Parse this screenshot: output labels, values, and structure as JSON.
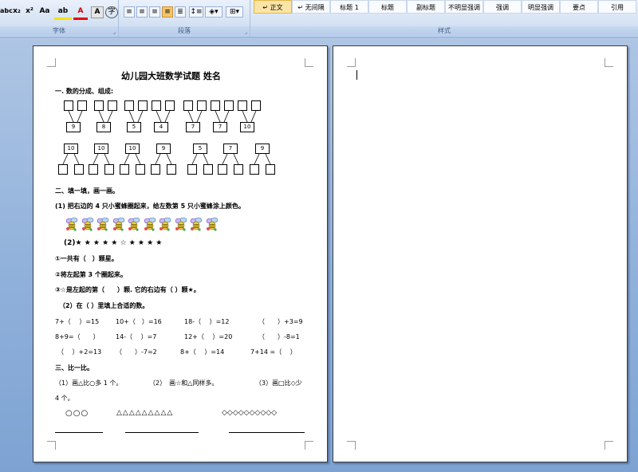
{
  "ribbon": {
    "groups": [
      {
        "label": "字体"
      },
      {
        "label": "段落"
      },
      {
        "label": "样式"
      }
    ],
    "font_buttons": [
      "abc",
      "x₂",
      "x²",
      "Aa",
      "ab",
      "A",
      "A"
    ],
    "styles": [
      "↵ 正文",
      "↵ 无间隔",
      "标题 1",
      "标题",
      "副标题",
      "不明显强调",
      "强调",
      "明显强调",
      "要点",
      "引用"
    ]
  },
  "doc": {
    "title": "幼儿园大班数学试题     姓名",
    "s1_heading": "一. 数的分成、组成:",
    "row1_numbers": [
      "9",
      "8",
      "5",
      "4",
      "7",
      "7",
      "10"
    ],
    "row2_numbers": [
      "10",
      "10",
      "10",
      "9",
      "5",
      "7",
      "9"
    ],
    "s2_heading": "二、填一填，画一画。",
    "q1": "(1) 把右边的 4 只小蜜蜂圈起来，给左数第 5 只小蜜蜂涂上颜色。",
    "q2_stars": "(2)★ ★ ★ ★ ★ ☆ ★ ★ ★ ★",
    "q2_a": "①一共有（　）颗星。",
    "q2_b": "②将左起第 3 个圈起来。",
    "q2_c": "③☆是左起的第（　　）颗. 它的右边有（ ）颗★。",
    "q3_heading": "（2）在（ ）里填上合适的数。",
    "eq_rows": [
      [
        "7+（　 ）=15",
        "10+（　）=16",
        "18-（　 ）=12",
        "（　　）+3=9"
      ],
      [
        "8+9=（　　）",
        "14-（　 ）=7",
        "12+（　 ）=20",
        "（　　）-8=1"
      ],
      [
        "（　 ）+2=13",
        "（　　）-7=2",
        "8+（　 ）=14",
        "7+14 =（　 ）"
      ]
    ],
    "s3_heading": "三、比一比。",
    "compare_1": "（1）画△比○多 1 个。",
    "compare_2": "（2）　画☆和△同样多。",
    "compare_3": "（3）画□比◇少",
    "compare_3b": "4 个。",
    "shapes_circles": "○○○",
    "shapes_triangles": "△△△△△△△△△",
    "shapes_diamonds": "◇◇◇◇◇◇◇◇◇◇"
  }
}
